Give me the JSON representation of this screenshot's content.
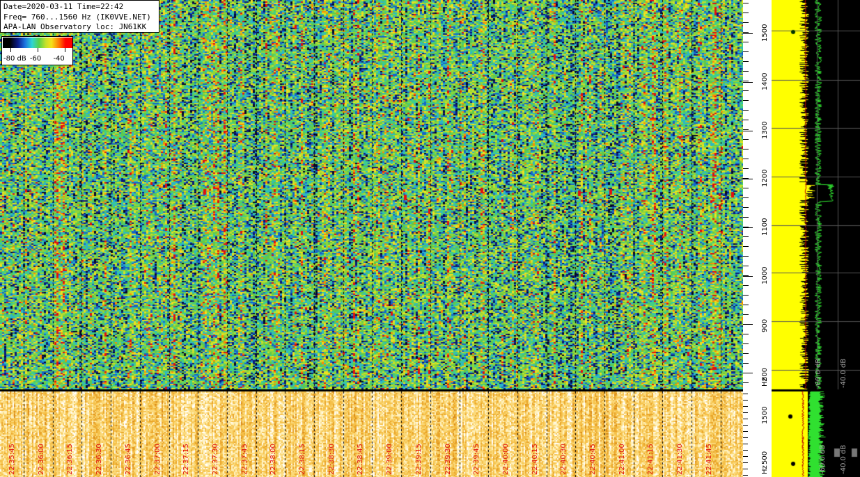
{
  "info": {
    "line1": "Date=2020-03-11 Time=22:42",
    "line2": "Freq= 760...1560 Hz (IK0VVE.NET)",
    "line3": "APA-LAN Observatory loc: JN61KK"
  },
  "color_scale": {
    "label_1": "-80 dB",
    "label_2": "-60",
    "label_3": "-40"
  },
  "freq_axis": {
    "ticks": [
      "1500",
      "1400",
      "1300",
      "1200",
      "1100",
      "1000",
      "900",
      "800"
    ],
    "unit": "Hz"
  },
  "lower_axis": {
    "ticks": [
      "1500",
      "500"
    ],
    "unit": "Hz"
  },
  "time_labels": [
    "22:35:45",
    "22:36:00",
    "22:36:15",
    "22:36:30",
    "22:36:45",
    "22:37:00",
    "22:37:15",
    "22:37:30",
    "22:37:45",
    "22:38:00",
    "22:38:15",
    "22:38:30",
    "22:38:45",
    "22:39:00",
    "22:39:15",
    "22:39:30",
    "22:39:45",
    "22:40:00",
    "22:40:15",
    "22:40:30",
    "22:40:45",
    "22:41:00",
    "22:41:15",
    "22:41:30",
    "22:41:45"
  ],
  "side_panel": {
    "upper_labels": [
      "-60.0 dB",
      "-40.0 dB"
    ],
    "lower_labels": [
      "-60.0 dB",
      "-40.0 dB"
    ]
  },
  "colors": {
    "spectrum_background": "#5fc94a",
    "lower_background": "#f3c45a",
    "accent_red": "#e01010",
    "spectrum_yellow": "#ffff00"
  }
}
